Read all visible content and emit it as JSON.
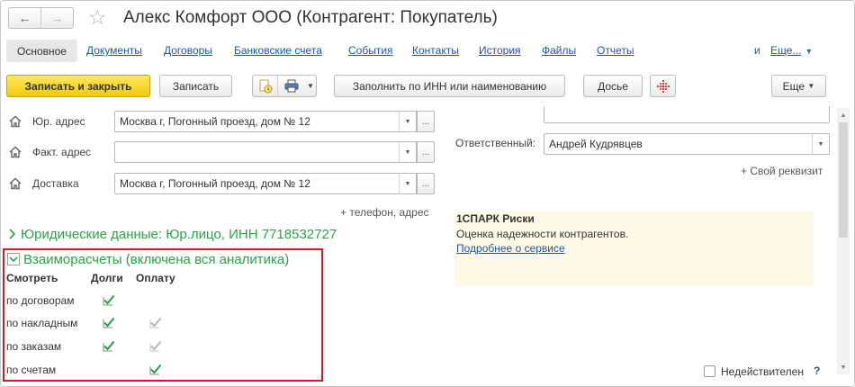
{
  "window": {
    "title": "Алекс Комфорт ООО (Контрагент: Покупатель)"
  },
  "nav": {
    "back_icon": "arrow-left-icon",
    "forward_icon": "arrow-right-icon",
    "favorite_icon": "star-icon"
  },
  "tabs": [
    {
      "label": "Основное",
      "active": true
    },
    {
      "label": "Документы"
    },
    {
      "label": "Договоры"
    },
    {
      "label": "Банковские счета"
    },
    {
      "label": "События"
    },
    {
      "label": "Контакты"
    },
    {
      "label": "История"
    },
    {
      "label": "Файлы"
    },
    {
      "label": "Отчеты"
    }
  ],
  "tabs_overflow": {
    "cut_label": "и",
    "more_label": "Еще..."
  },
  "toolbar": {
    "save_close": "Записать и закрыть",
    "save": "Записать",
    "fill_inn": "Заполнить по ИНН или наименованию",
    "dossier": "Досье",
    "more": "Еще"
  },
  "addresses": [
    {
      "label": "Юр. адрес",
      "value": "Москва г, Погонный проезд, дом № 12"
    },
    {
      "label": "Факт. адрес",
      "value": ""
    },
    {
      "label": "Доставка",
      "value": "Москва г, Погонный проезд, дом № 12"
    }
  ],
  "phone_link": "+ телефон, адрес",
  "legal_section": "Юридические данные: Юр.лицо, ИНН 7718532727",
  "settlement": {
    "title": "Взаиморасчеты (включена вся аналитика)",
    "headers": {
      "view": "Смотреть",
      "debts": "Долги",
      "payment": "Оплату"
    },
    "rows": [
      {
        "label": "по договорам",
        "debts": "checked",
        "payment": "none"
      },
      {
        "label": "по накладным",
        "debts": "checked",
        "payment": "disabled"
      },
      {
        "label": "по заказам",
        "debts": "checked",
        "payment": "disabled"
      },
      {
        "label": "по счетам",
        "debts": "none",
        "payment": "checked"
      }
    ]
  },
  "responsible": {
    "label": "Ответственный:",
    "value": "Андрей Кудрявцев"
  },
  "own_requisite": "+ Свой реквизит",
  "spark": {
    "title": "1СПАРК Риски",
    "description": "Оценка надежности контрагентов.",
    "link": "Подробнее о сервисе"
  },
  "inactive": {
    "label": "Недействителен",
    "help": "?"
  },
  "colors": {
    "accent_yellow": "#f2c811",
    "link_blue": "#1b58a8",
    "section_green": "#28a346",
    "highlight_red": "#e0141e"
  }
}
